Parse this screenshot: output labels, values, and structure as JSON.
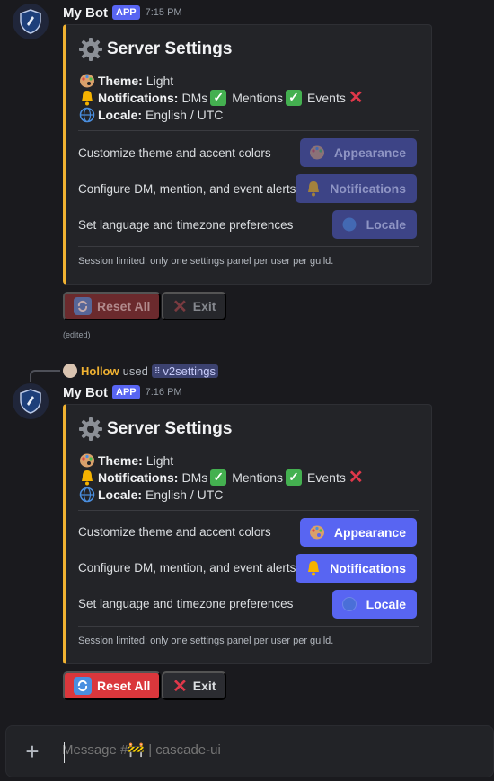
{
  "messages": [
    {
      "username": "My Bot",
      "badge": "APP",
      "time": "7:15 PM",
      "embed": {
        "title": "Server Settings",
        "theme_label": "Theme:",
        "theme_value": "Light",
        "notif_label": "Notifications:",
        "notif_dms": "DMs",
        "notif_mentions": "Mentions",
        "notif_events": "Events",
        "locale_label": "Locale:",
        "locale_value": "English / UTC",
        "rows": [
          {
            "label": "Customize theme and accent colors",
            "button": "Appearance"
          },
          {
            "label": "Configure DM, mention, and event alerts",
            "button": "Notifications"
          },
          {
            "label": "Set language and timezone preferences",
            "button": "Locale"
          }
        ],
        "footer": "Session limited: only one settings panel per user per guild."
      },
      "reset_label": "Reset All",
      "exit_label": "Exit",
      "edited": "(edited)",
      "disabled": true
    },
    {
      "username": "My Bot",
      "badge": "APP",
      "time": "7:16 PM",
      "embed": {
        "title": "Server Settings",
        "theme_label": "Theme:",
        "theme_value": "Light",
        "notif_label": "Notifications:",
        "notif_dms": "DMs",
        "notif_mentions": "Mentions",
        "notif_events": "Events",
        "locale_label": "Locale:",
        "locale_value": "English / UTC",
        "rows": [
          {
            "label": "Customize theme and accent colors",
            "button": "Appearance"
          },
          {
            "label": "Configure DM, mention, and event alerts",
            "button": "Notifications"
          },
          {
            "label": "Set language and timezone preferences",
            "button": "Locale"
          }
        ],
        "footer": "Session limited: only one settings panel per user per guild."
      },
      "reset_label": "Reset All",
      "exit_label": "Exit",
      "disabled": false
    }
  ],
  "reply": {
    "user": "Hollow",
    "used": "used",
    "command": "v2settings"
  },
  "composer": {
    "placeholder": "Message #🚧 | cascade-ui"
  },
  "colors": {
    "accent": "#5865f2",
    "embed_bar": "#f0b232",
    "danger": "#da373c",
    "check": "#44b050"
  }
}
